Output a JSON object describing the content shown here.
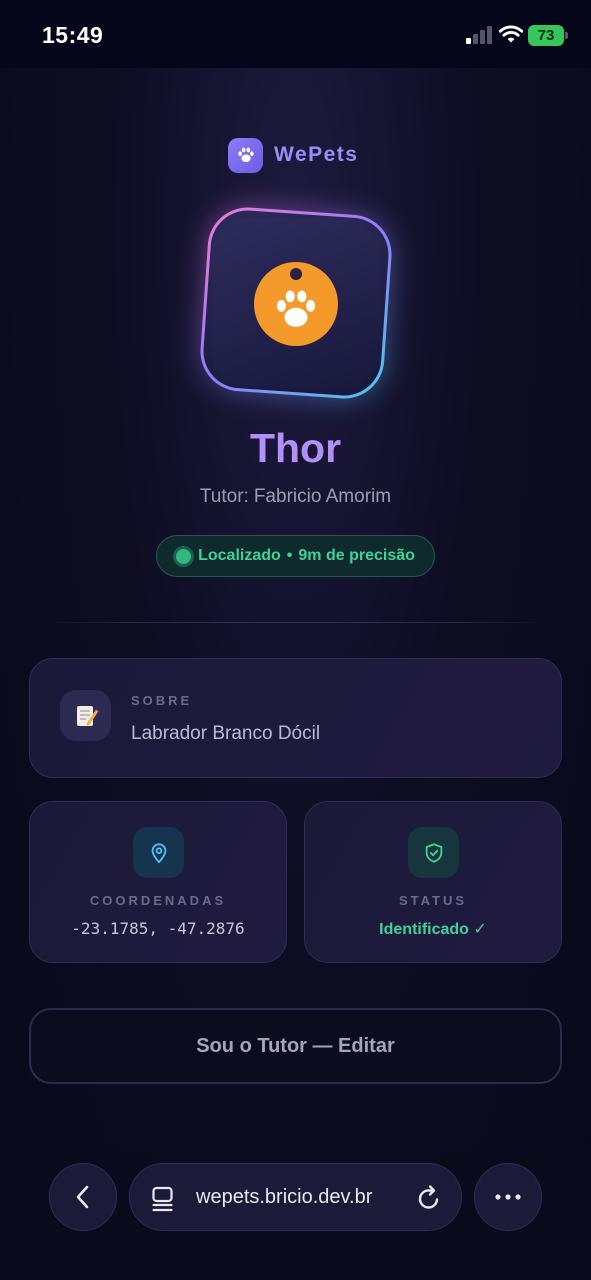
{
  "status_bar": {
    "time": "15:49",
    "battery": "73"
  },
  "brand": {
    "name": "WePets",
    "icon": "paw-icon"
  },
  "pet": {
    "name": "Thor",
    "tutor_label": "Tutor:",
    "tutor_name": "Fabricio Amorim",
    "location_status": "Localizado",
    "location_separator": "•",
    "location_precision": "9m de precisão"
  },
  "about": {
    "icon": "memo-icon",
    "label": "SOBRE",
    "text": "Labrador Branco Dócil"
  },
  "coordinates": {
    "icon": "map-pin-icon",
    "label": "COORDENADAS",
    "value": "-23.1785, -47.2876"
  },
  "status": {
    "icon": "shield-check-icon",
    "label": "STATUS",
    "value": "Identificado ✓"
  },
  "actions": {
    "edit_label": "Sou o Tutor — Editar"
  },
  "browser": {
    "url": "wepets.bricio.dev.br"
  },
  "colors": {
    "accent": "#b290f8",
    "brand": "#9d8cf5",
    "success": "#3fd39b",
    "badge": "#f39a2a"
  }
}
